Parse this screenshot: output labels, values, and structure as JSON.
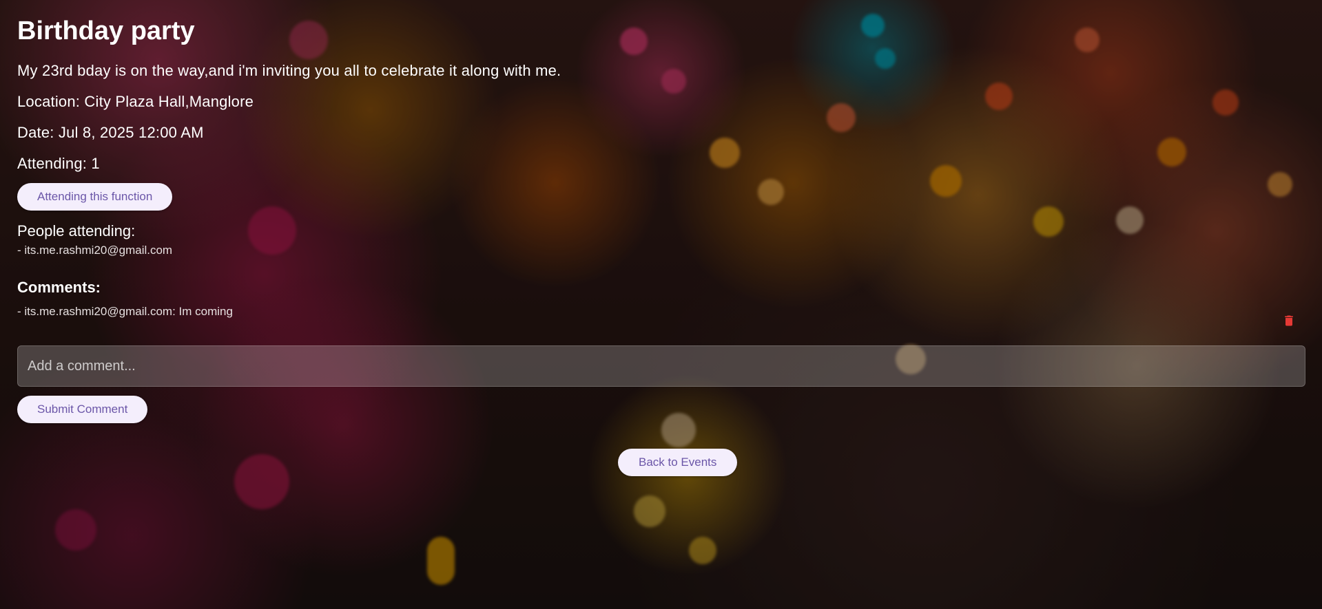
{
  "event": {
    "title": "Birthday party",
    "description": "My 23rd bday is on the way,and i'm inviting you all to celebrate it along with me.",
    "location": "Location: City Plaza Hall,Manglore",
    "date": "Date: Jul 8, 2025 12:00 AM",
    "attending": "Attending: 1",
    "attend_button_label": "Attending this function"
  },
  "people": {
    "heading": "People attending:",
    "items": [
      "- its.me.rashmi20@gmail.com"
    ]
  },
  "comments": {
    "heading": "Comments:",
    "items": [
      {
        "text": "- its.me.rashmi20@gmail.com: Im coming",
        "delete_icon": "trash-icon"
      }
    ],
    "input_placeholder": "Add a comment...",
    "submit_label": "Submit Comment"
  },
  "navigation": {
    "back_label": "Back to Events"
  },
  "colors": {
    "button_bg": "#f4eefc",
    "button_text": "#6b56a8",
    "delete_icon": "#e53935"
  }
}
